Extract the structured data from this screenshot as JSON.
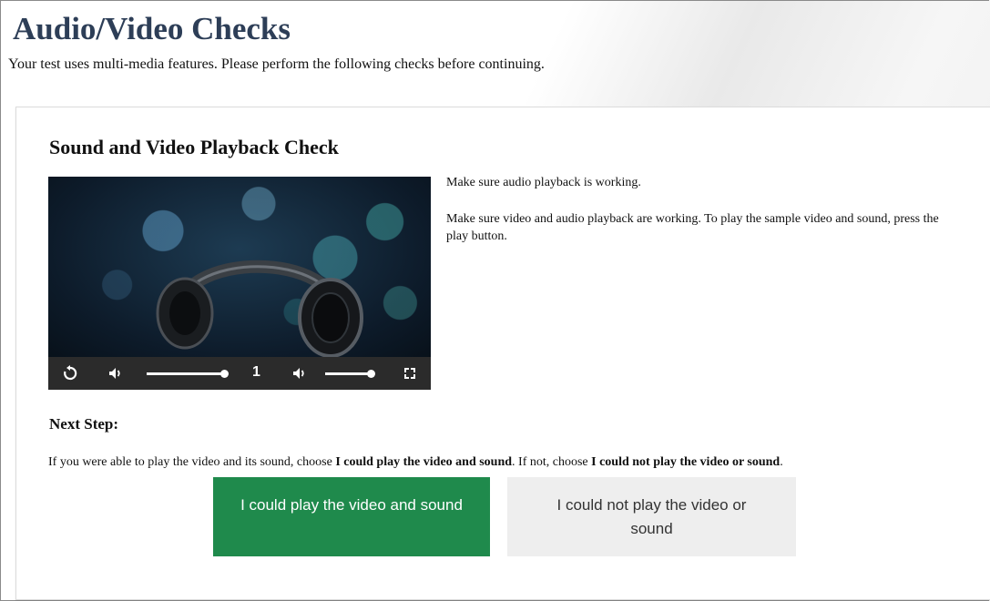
{
  "header": {
    "title": "Audio/Video Checks",
    "subtitle": "Your test uses multi-media features. Please perform the following checks before continuing."
  },
  "check": {
    "title": "Sound and Video Playback Check",
    "instruction_audio": "Make sure audio playback is working.",
    "instruction_video": "Make sure video and audio playback are working. To play the sample video and sound, press the play button."
  },
  "player": {
    "speed_value": "1",
    "volume_level": 1.0,
    "second_volume_level": 1.0,
    "icons": [
      "replay-icon",
      "volume-icon",
      "volume-icon",
      "fullscreen-icon"
    ]
  },
  "next_step": {
    "heading": "Next Step:",
    "text_prefix": "If you were able to play the video and its sound, choose ",
    "option_yes_inline": "I could play the video and sound",
    "text_middle": ". If not, choose ",
    "option_no_inline": "I could not play the video or sound",
    "text_suffix": "."
  },
  "buttons": {
    "yes_label": "I could play the video and sound",
    "no_label": "I could not play the video or sound"
  },
  "colors": {
    "title": "#2d3e57",
    "yes_button": "#1f8a4c",
    "no_button": "#eeeeee",
    "player_controls": "#2b2b2b"
  }
}
